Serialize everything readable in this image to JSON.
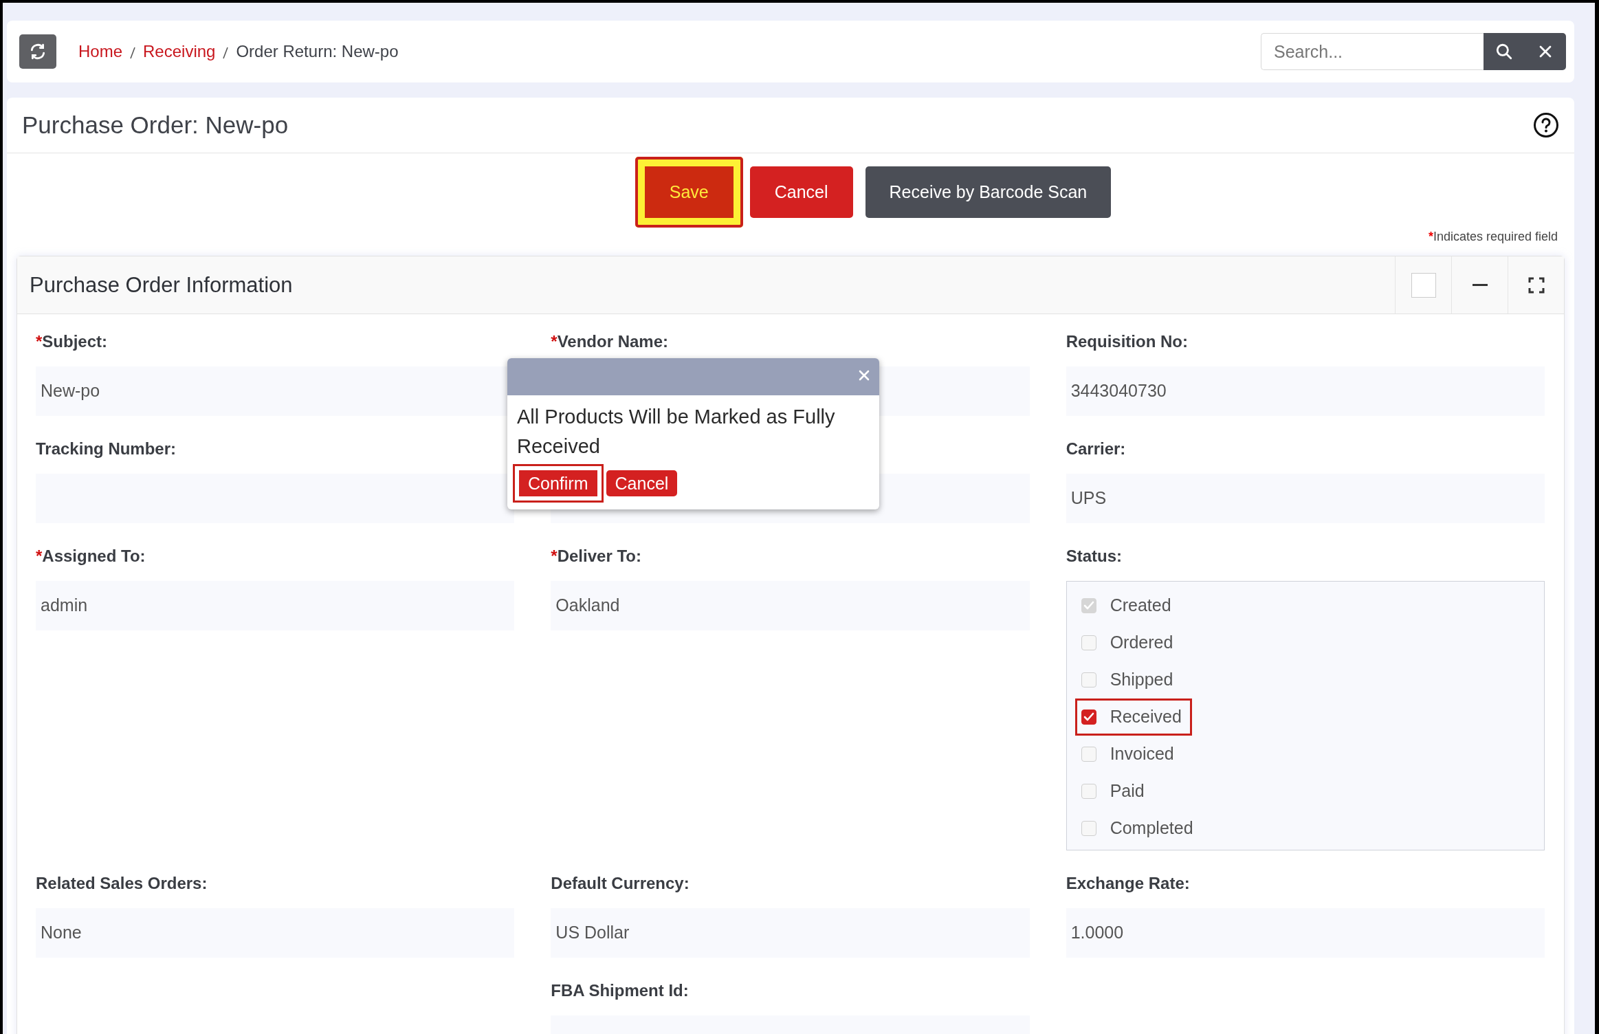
{
  "breadcrumbs": [
    {
      "label": "Home",
      "kind": "link"
    },
    {
      "label": "Receiving",
      "kind": "link"
    },
    {
      "label": "Order Return: New-po",
      "kind": "current"
    }
  ],
  "search": {
    "placeholder": "Search..."
  },
  "page_title": "Purchase Order: New-po",
  "actions": [
    {
      "label": "Save",
      "kind": "save",
      "highlighted": true
    },
    {
      "label": "Cancel",
      "kind": "cancel",
      "highlighted": false
    },
    {
      "label": "Receive by Barcode Scan",
      "kind": "dark",
      "highlighted": false
    }
  ],
  "required_note": {
    "mark": "*",
    "text": "Indicates required field"
  },
  "panel": {
    "title": "Purchase Order Information",
    "fields": [
      {
        "kind": "text",
        "required_mark": "*",
        "label": "Subject:",
        "value": "New-po"
      },
      {
        "kind": "text",
        "required_mark": "*",
        "label": "Vendor Name:"
      },
      {
        "kind": "text",
        "label": "Requisition No:",
        "value": "3443040730"
      },
      {
        "kind": "text",
        "label": "Tracking Number:"
      },
      {
        "kind": "text"
      },
      {
        "kind": "text",
        "label": "Carrier:",
        "value": "UPS"
      },
      {
        "kind": "text",
        "required_mark": "*",
        "label": "Assigned To:",
        "value": "admin"
      },
      {
        "kind": "text",
        "required_mark": "*",
        "label": "Deliver To:",
        "value": "Oakland"
      },
      {
        "kind": "checklist",
        "label": "Status:",
        "options": [
          {
            "label": "Created",
            "checked": true,
            "disabled": true,
            "highlighted": false
          },
          {
            "label": "Ordered",
            "checked": false,
            "disabled": false,
            "highlighted": false
          },
          {
            "label": "Shipped",
            "checked": false,
            "disabled": false,
            "highlighted": false
          },
          {
            "label": "Received",
            "checked": true,
            "disabled": false,
            "highlighted": true
          },
          {
            "label": "Invoiced",
            "checked": false,
            "disabled": false,
            "highlighted": false
          },
          {
            "label": "Paid",
            "checked": false,
            "disabled": false,
            "highlighted": false
          },
          {
            "label": "Completed",
            "checked": false,
            "disabled": false,
            "highlighted": false
          }
        ]
      },
      {
        "kind": "text",
        "label": "Related Sales Orders:",
        "value": "None"
      },
      {
        "kind": "text",
        "label": "Default Currency:",
        "value": "US Dollar"
      },
      {
        "kind": "text",
        "label": "Exchange Rate:",
        "value": "1.0000"
      },
      {
        "kind": "empty"
      },
      {
        "kind": "text",
        "label": "FBA Shipment Id:"
      },
      {
        "kind": "empty"
      }
    ]
  },
  "dialog": {
    "message": "All Products Will be Marked as Fully Received",
    "buttons": [
      {
        "label": "Confirm",
        "highlighted": true
      },
      {
        "label": "Cancel",
        "highlighted": false
      }
    ]
  }
}
